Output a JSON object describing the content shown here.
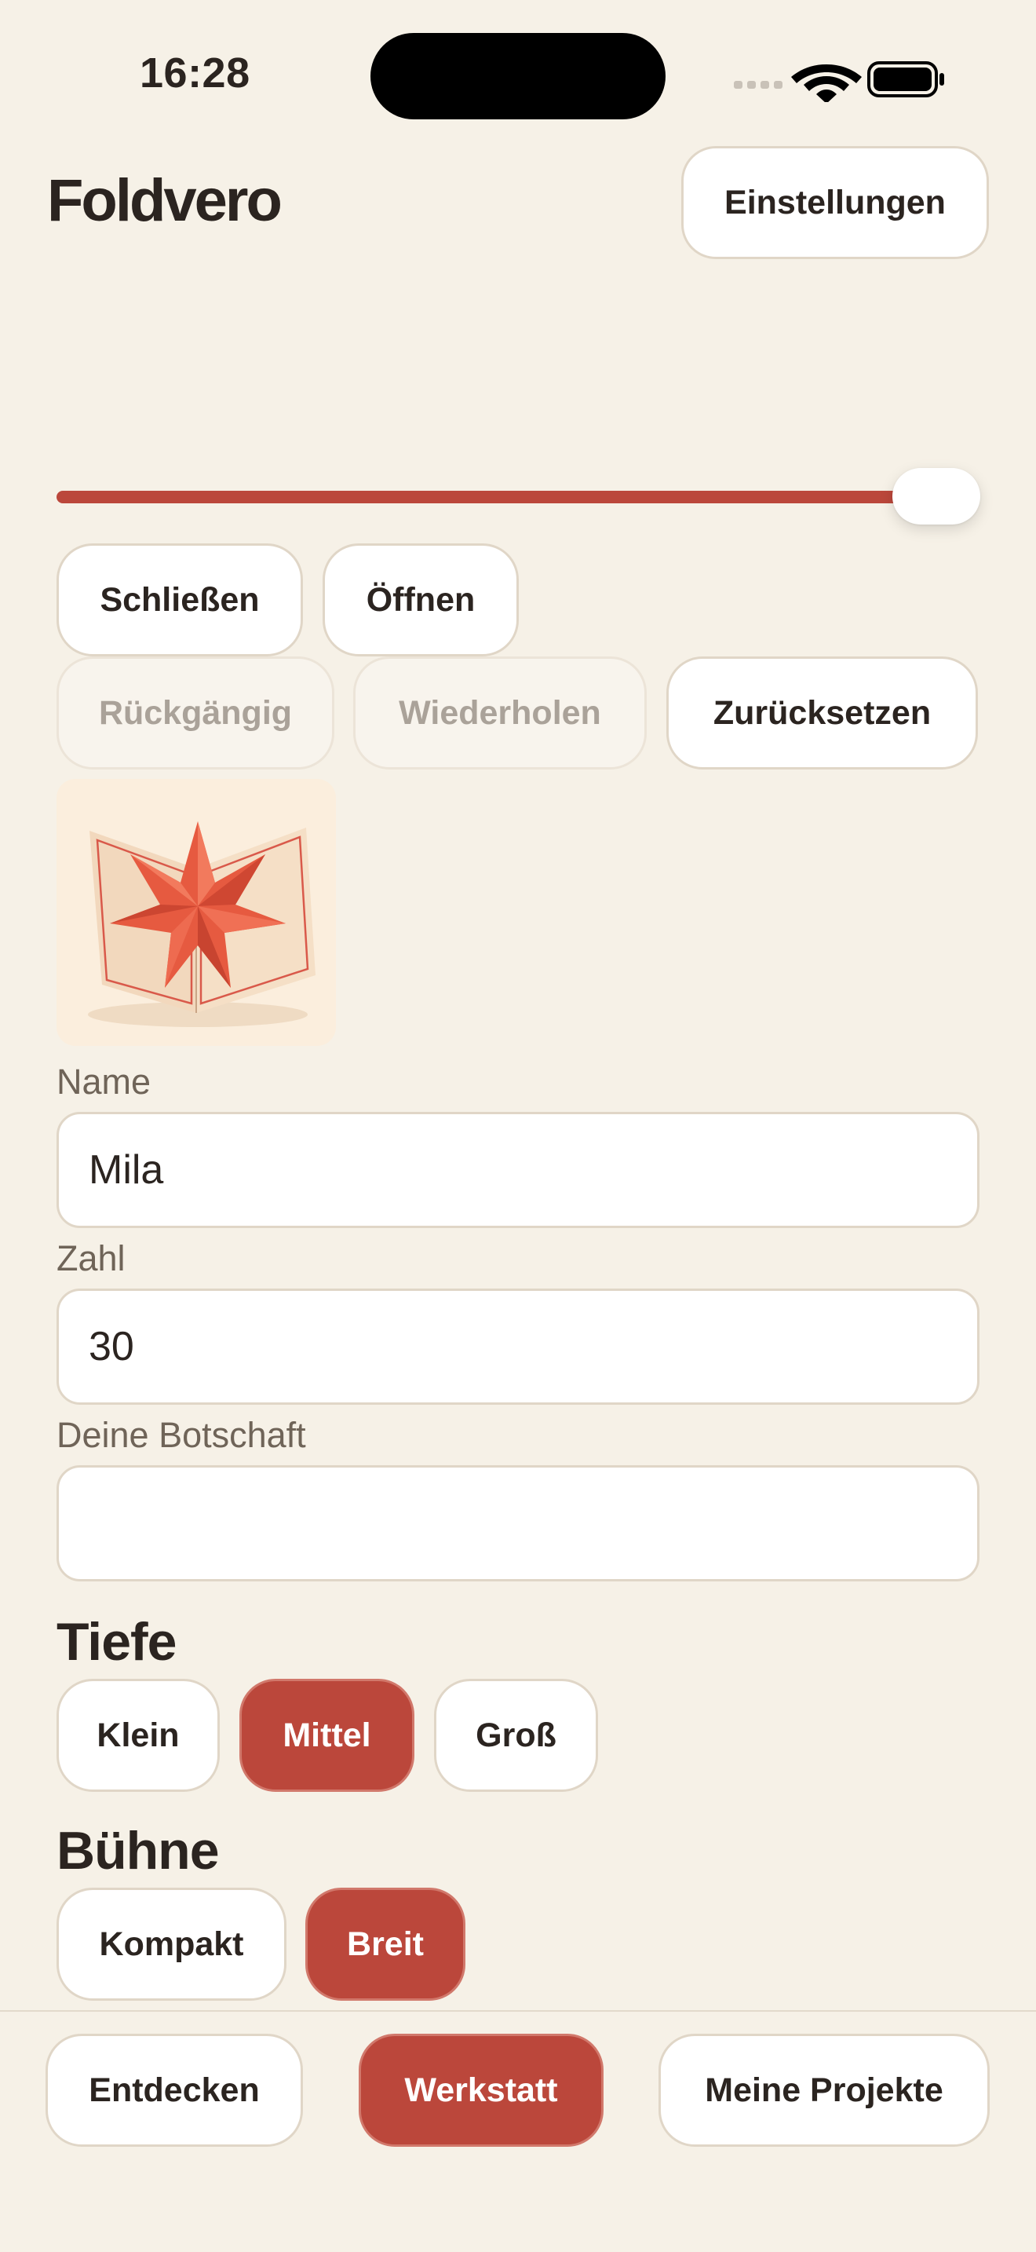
{
  "status_bar": {
    "time": "16:28"
  },
  "header": {
    "app_title": "Foldvero",
    "settings_label": "Einstellungen"
  },
  "fold_slider": {
    "value": 1.0
  },
  "actions": {
    "close_label": "Schließen",
    "open_label": "Öffnen",
    "undo_label": "Rückgängig",
    "redo_label": "Wiederholen",
    "reset_label": "Zurücksetzen"
  },
  "preview": {
    "icon": "pop-up-star-card-icon",
    "colors": {
      "star": "#e4583f",
      "card": "#f5dcc2"
    }
  },
  "form": {
    "name": {
      "label": "Name",
      "value": "Mila"
    },
    "number": {
      "label": "Zahl",
      "value": "30"
    },
    "message": {
      "label": "Deine Botschaft",
      "value": ""
    }
  },
  "depth": {
    "title": "Tiefe",
    "options": [
      "Klein",
      "Mittel",
      "Groß"
    ],
    "selected": "Mittel"
  },
  "stage": {
    "title": "Bühne",
    "options": [
      "Kompakt",
      "Breit"
    ],
    "selected": "Breit"
  },
  "tabs": {
    "discover": "Entdecken",
    "workshop": "Werkstatt",
    "projects": "Meine Projekte",
    "selected": "Werkstatt"
  },
  "colors": {
    "accent": "#bb473b",
    "background": "#f6f1e7",
    "border": "#e0d6c7"
  }
}
